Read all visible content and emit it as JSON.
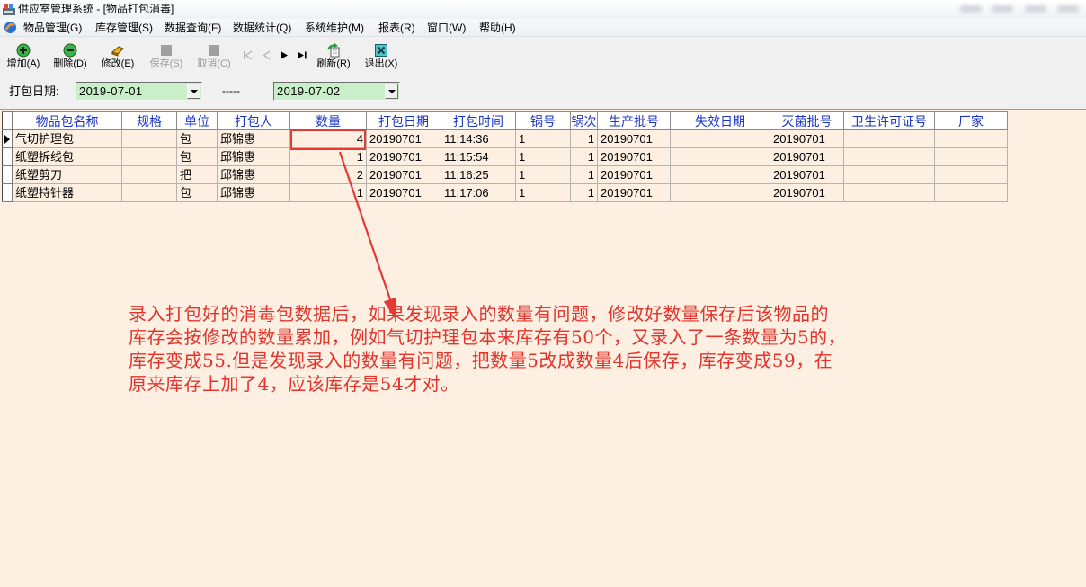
{
  "window": {
    "title": "供应室管理系统 - [物品打包消毒]",
    "app_icon": "app-icon"
  },
  "menu": {
    "icon": "app-globe-icon",
    "items": [
      "物品管理(G)",
      "库存管理(S)",
      "数据查询(F)",
      "数据统计(Q)",
      "系统维护(M)",
      "报表(R)",
      "窗口(W)",
      "帮助(H)"
    ]
  },
  "toolbar": {
    "buttons": [
      {
        "label": "增加(A)",
        "icon": "add-icon",
        "enabled": true
      },
      {
        "label": "删除(D)",
        "icon": "delete-icon",
        "enabled": true
      },
      {
        "label": "修改(E)",
        "icon": "edit-icon",
        "enabled": true
      },
      {
        "label": "保存(S)",
        "icon": "save-icon",
        "enabled": false
      },
      {
        "label": "取消(C)",
        "icon": "cancel-icon",
        "enabled": false
      },
      {
        "label": "刷新(R)",
        "icon": "refresh-icon",
        "enabled": true
      },
      {
        "label": "退出(X)",
        "icon": "exit-icon",
        "enabled": true
      }
    ],
    "navigation": [
      {
        "icon": "first-record-icon",
        "enabled": false
      },
      {
        "icon": "prev-record-icon",
        "enabled": false
      },
      {
        "icon": "next-record-icon",
        "enabled": true
      },
      {
        "icon": "last-record-icon",
        "enabled": true
      }
    ]
  },
  "filter": {
    "label": "打包日期:",
    "date_from": "2019-07-01",
    "separator": "-----",
    "date_to": "2019-07-02"
  },
  "grid": {
    "columns": [
      "物品包名称",
      "规格",
      "单位",
      "打包人",
      "数量",
      "打包日期",
      "打包时间",
      "锅号",
      "锅次",
      "生产批号",
      "失效日期",
      "灭菌批号",
      "卫生许可证号",
      "厂家"
    ],
    "current_row_index": 0,
    "rows": [
      [
        "气切护理包",
        "",
        "包",
        "邱锦惠",
        "4",
        "20190701",
        "11:14:36",
        "1",
        "1",
        "20190701",
        "",
        "20190701",
        "",
        ""
      ],
      [
        "纸塑拆线包",
        "",
        "包",
        "邱锦惠",
        "1",
        "20190701",
        "11:15:54",
        "1",
        "1",
        "20190701",
        "",
        "20190701",
        "",
        ""
      ],
      [
        "纸塑剪刀",
        "",
        "把",
        "邱锦惠",
        "2",
        "20190701",
        "11:16:25",
        "1",
        "1",
        "20190701",
        "",
        "20190701",
        "",
        ""
      ],
      [
        "纸塑持针器",
        "",
        "包",
        "邱锦惠",
        "1",
        "20190701",
        "11:17:06",
        "1",
        "1",
        "20190701",
        "",
        "20190701",
        "",
        ""
      ]
    ]
  },
  "annotation": {
    "lines": [
      "录入打包好的消毒包数据后，如果发现录入的数量有问题，修改好数量保存后该物品的",
      "库存会按修改的数量累加，例如气切护理包本来库存有50个，又录入了一条数量为5的，",
      "库存变成55.但是发现录入的数量有问题，把数量5改成数量4后保存，库存变成59，在",
      "原来库存上加了4，应该库存是54才对。"
    ]
  },
  "colors": {
    "workspace_background": "#fdefe2",
    "header_text": "#1a35c8",
    "date_field_background": "#c9efc9",
    "annotation_red": "#e2342b"
  }
}
